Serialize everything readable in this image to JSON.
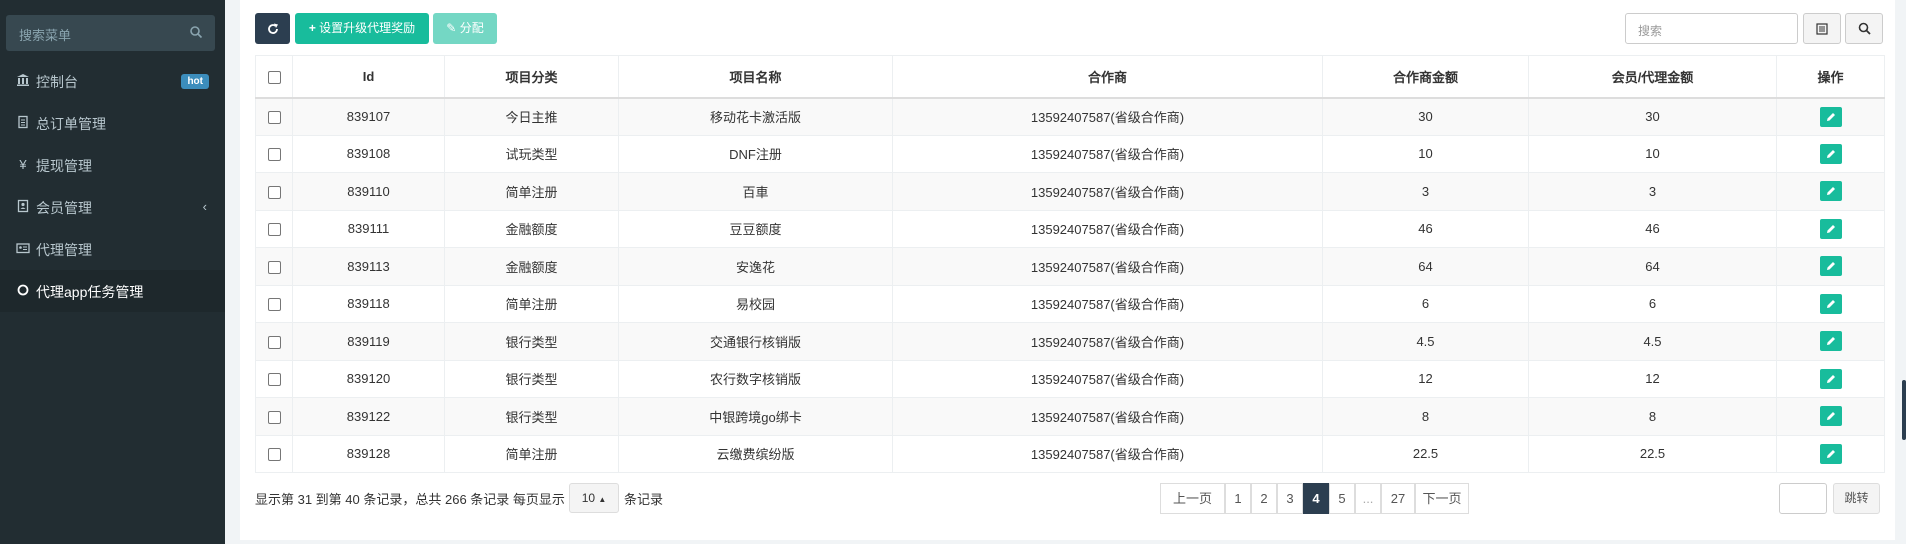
{
  "sidebar": {
    "search_placeholder": "搜索菜单",
    "items": [
      {
        "label": "控制台",
        "badge": "hot"
      },
      {
        "label": "总订单管理"
      },
      {
        "label": "提现管理"
      },
      {
        "label": "会员管理"
      },
      {
        "label": "代理管理"
      },
      {
        "label": "代理app任务管理"
      }
    ]
  },
  "toolbar": {
    "reward_label": "设置升级代理奖励",
    "assign_label": "分配",
    "search_placeholder": "搜索"
  },
  "table": {
    "headers": [
      "Id",
      "项目分类",
      "项目名称",
      "合作商",
      "合作商金额",
      "会员/代理金额",
      "操作"
    ],
    "rows": [
      [
        "839107",
        "今日主推",
        "移动花卡激活版",
        "13592407587(省级合作商)",
        "30",
        "30"
      ],
      [
        "839108",
        "试玩类型",
        "DNF注册",
        "13592407587(省级合作商)",
        "10",
        "10"
      ],
      [
        "839110",
        "简单注册",
        "百車",
        "13592407587(省级合作商)",
        "3",
        "3"
      ],
      [
        "839111",
        "金融额度",
        "豆豆额度",
        "13592407587(省级合作商)",
        "46",
        "46"
      ],
      [
        "839113",
        "金融额度",
        "安逸花",
        "13592407587(省级合作商)",
        "64",
        "64"
      ],
      [
        "839118",
        "简单注册",
        "易校园",
        "13592407587(省级合作商)",
        "6",
        "6"
      ],
      [
        "839119",
        "银行类型",
        "交通银行核销版",
        "13592407587(省级合作商)",
        "4.5",
        "4.5"
      ],
      [
        "839120",
        "银行类型",
        "农行数字核销版",
        "13592407587(省级合作商)",
        "12",
        "12"
      ],
      [
        "839122",
        "银行类型",
        "中银跨境go绑卡",
        "13592407587(省级合作商)",
        "8",
        "8"
      ],
      [
        "839128",
        "简单注册",
        "云缴费缤纷版",
        "13592407587(省级合作商)",
        "22.5",
        "22.5"
      ]
    ]
  },
  "footer": {
    "summary": "显示第 31 到第 40 条记录，总共 266 条记录 每页显示",
    "page_size": "10",
    "suffix": "条记录",
    "pages": [
      "上一页",
      "1",
      "2",
      "3",
      "4",
      "5",
      "...",
      "27",
      "下一页"
    ],
    "active_page": "4",
    "jump_label": "跳转"
  },
  "colors": {
    "sidebar_bg": "#222d32",
    "primary": "#2c3e50",
    "success": "#18bc9c",
    "badge": "#3c8dbc"
  }
}
